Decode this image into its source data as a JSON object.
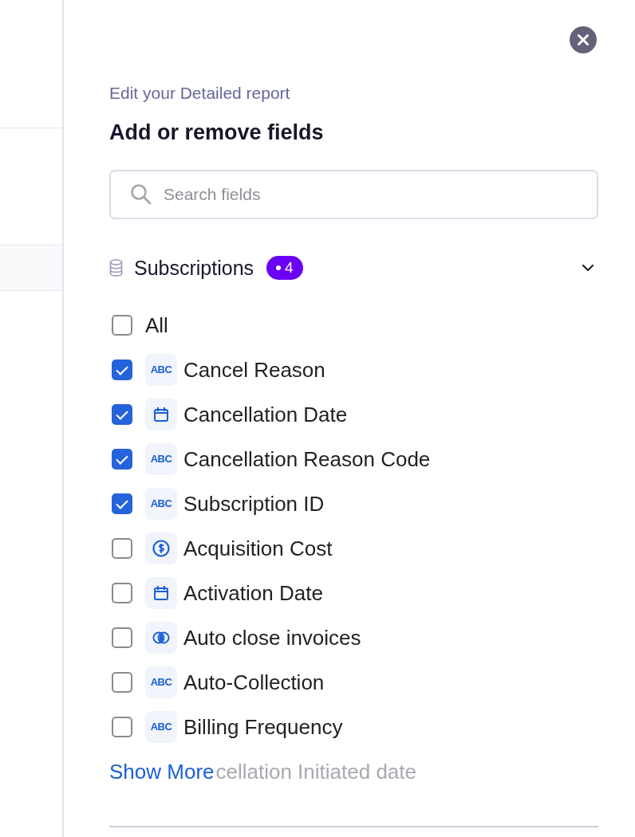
{
  "panel": {
    "subtitle": "Edit your Detailed report",
    "title": "Add or remove fields"
  },
  "search": {
    "placeholder": "Search fields"
  },
  "section": {
    "name": "Subscriptions",
    "badge": "4",
    "expanded": true,
    "select_all": {
      "label": "All",
      "checked": false
    },
    "fields": [
      {
        "label": "Cancel Reason",
        "kind": "text",
        "type_label": "ABC",
        "checked": true
      },
      {
        "label": "Cancellation Date",
        "kind": "date",
        "checked": true
      },
      {
        "label": "Cancellation Reason Code",
        "kind": "text",
        "type_label": "ABC",
        "checked": true
      },
      {
        "label": "Subscription ID",
        "kind": "text",
        "type_label": "ABC",
        "checked": true
      },
      {
        "label": "Acquisition Cost",
        "kind": "currency",
        "checked": false
      },
      {
        "label": "Activation Date",
        "kind": "date",
        "checked": false
      },
      {
        "label": "Auto close invoices",
        "kind": "boolean",
        "checked": false
      },
      {
        "label": "Auto-Collection",
        "kind": "text",
        "type_label": "ABC",
        "checked": false
      },
      {
        "label": "Billing Frequency",
        "kind": "text",
        "type_label": "ABC",
        "checked": false
      }
    ],
    "show_more": "Show More",
    "faded_field": "cellation Initiated date"
  }
}
